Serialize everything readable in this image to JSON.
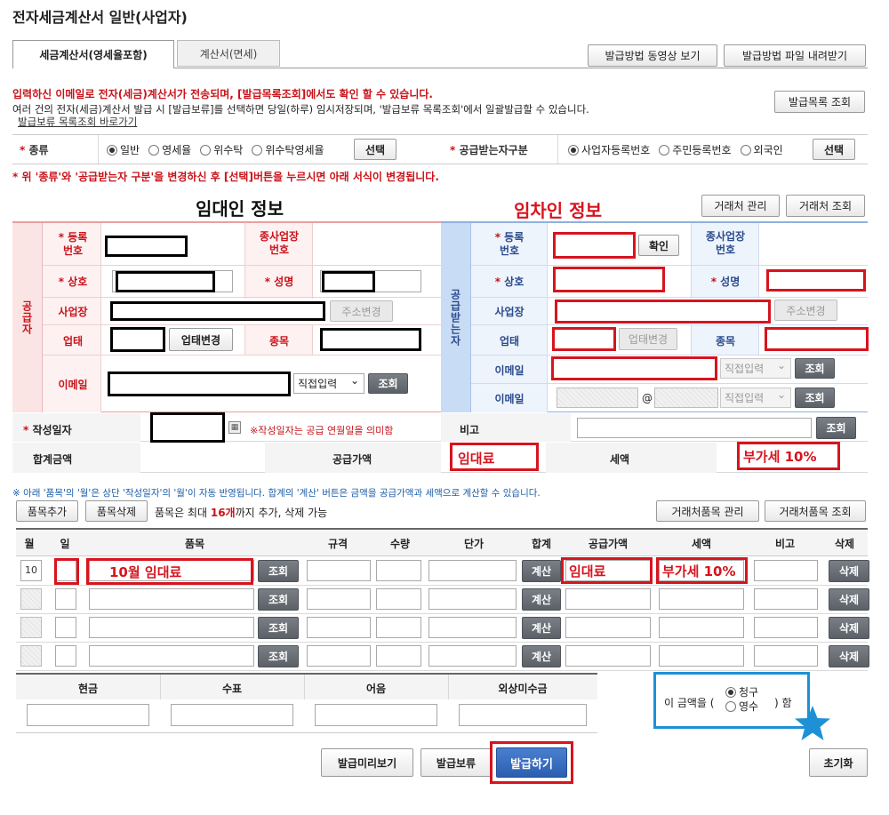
{
  "page_title": "전자세금계산서 일반(사업자)",
  "tabs": [
    {
      "label": "세금계산서(영세율포함)",
      "active": true
    },
    {
      "label": "계산서(면세)",
      "active": false
    }
  ],
  "top_buttons": {
    "video": "발급방법 동영상 보기",
    "file": "발급방법 파일 내려받기",
    "list": "발급목록 조회"
  },
  "notice": {
    "line1": "입력하신 이메일로 전자(세금)계산서가 전송되며, [발급목록조회]에서도 확인 할 수 있습니다.",
    "line2": "여러 건의 전자(세금)계산서 발급 시 [발급보류]를 선택하면 당일(하루) 임시저장되며, '발급보류 목록조회'에서 일괄발급할 수 있습니다.",
    "link": "발급보류 목록조회 바로가기"
  },
  "type_row": {
    "type_label": "종류",
    "type_options": [
      "일반",
      "영세율",
      "위수탁",
      "위수탁영세율"
    ],
    "type_selected": "일반",
    "select_btn": "선택",
    "receiver_label": "공급받는자구분",
    "receiver_options": [
      "사업자등록번호",
      "주민등록번호",
      "외국인"
    ],
    "receiver_selected": "사업자등록번호"
  },
  "change_notice": "* 위 '종류'와 '공급받는자 구분'을 변경하신 후 [선택]버튼을 누르시면 아래 서식이 변경됩니다.",
  "annotations": {
    "landlord": "임대인 정보",
    "tenant": "임차인 정보",
    "rent": "임대료",
    "vat": "부가세 10%",
    "item": "10월 임대료"
  },
  "partner_buttons": {
    "manage": "거래처 관리",
    "lookup": "거래처 조회"
  },
  "supplier": {
    "side_label": "공급자",
    "reg_no": "등록\n번호",
    "sub_no": "종사업장\n번호",
    "name": "상호",
    "ceo": "성명",
    "address": "사업장",
    "addr_btn": "주소변경",
    "biz_type": "업태",
    "biz_btn": "업태변경",
    "biz_item": "종목",
    "email": "이메일",
    "email_select": "직접입력",
    "lookup": "조회"
  },
  "receiver": {
    "side_label": "공급받는자",
    "reg_no": "등록\n번호",
    "confirm": "확인",
    "sub_no": "종사업장\n번호",
    "name": "상호",
    "ceo": "성명",
    "address": "사업장",
    "addr_btn": "주소변경",
    "biz_type": "업태",
    "biz_btn": "업태변경",
    "biz_item": "종목",
    "email": "이메일",
    "email2": "이메일",
    "email_select": "직접입력",
    "lookup": "조회",
    "at": "@"
  },
  "date_row": {
    "label": "작성일자",
    "note": "※작성일자는 공급 연월일을 의미함",
    "memo_label": "비고",
    "lookup": "조회"
  },
  "sum_row": {
    "total": "합계금액",
    "supply": "공급가액",
    "tax": "세액"
  },
  "items_notice": "※ 아래 '품목'의 '월'은 상단 '작성일자'의 '월'이 자동 반영됩니다. 합계의 '계산' 버튼은 금액을 공급가액과 세액으로 계산할 수 있습니다.",
  "items_toolbar": {
    "add": "품목추가",
    "del": "품목삭제",
    "limit_pre": "품목은 최대 ",
    "limit_num": "16개",
    "limit_post": "까지 추가, 삭제 가능",
    "manage": "거래처품목 관리",
    "lookup": "거래처품목 조회"
  },
  "items_headers": [
    "월",
    "일",
    "품목",
    "규격",
    "수량",
    "단가",
    "합계",
    "공급가액",
    "세액",
    "비고",
    "삭제"
  ],
  "item_rows": [
    {
      "month": "10",
      "lookup": "조회",
      "calc": "계산",
      "del": "삭제"
    },
    {
      "month": "",
      "lookup": "조회",
      "calc": "계산",
      "del": "삭제"
    },
    {
      "month": "",
      "lookup": "조회",
      "calc": "계산",
      "del": "삭제"
    },
    {
      "month": "",
      "lookup": "조회",
      "calc": "계산",
      "del": "삭제"
    }
  ],
  "payment_headers": [
    "현금",
    "수표",
    "어음",
    "외상미수금"
  ],
  "claim_box": {
    "prefix": "이 금액을 (",
    "opt1": "청구",
    "opt2": "영수",
    "suffix": ") 함",
    "selected": "청구"
  },
  "bottom_buttons": {
    "preview": "발급미리보기",
    "hold": "발급보류",
    "issue": "발급하기",
    "reset": "초기화"
  },
  "colors": {
    "supplier_accent": "#e8a0a0",
    "receiver_accent": "#8fb0e0",
    "annotation_red": "#d7141e",
    "annotation_blue": "#1e90d6"
  }
}
